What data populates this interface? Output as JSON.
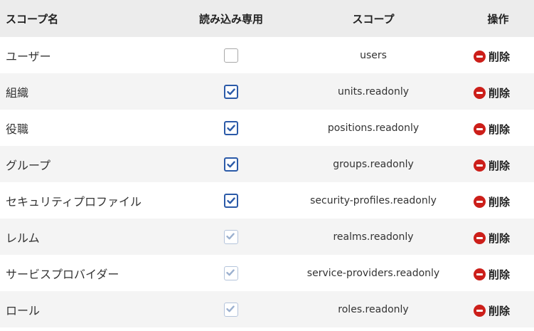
{
  "table": {
    "headers": {
      "name": "スコープ名",
      "readonly": "読み込み専用",
      "scope": "スコープ",
      "operation": "操作"
    },
    "delete_label": "削除",
    "rows": [
      {
        "name": "ユーザー",
        "scope": "users",
        "readonly": false,
        "disabled": false
      },
      {
        "name": "組織",
        "scope": "units.readonly",
        "readonly": true,
        "disabled": false
      },
      {
        "name": "役職",
        "scope": "positions.readonly",
        "readonly": true,
        "disabled": false
      },
      {
        "name": "グループ",
        "scope": "groups.readonly",
        "readonly": true,
        "disabled": false
      },
      {
        "name": "セキュリティプロファイル",
        "scope": "security-profiles.readonly",
        "readonly": true,
        "disabled": false
      },
      {
        "name": "レルム",
        "scope": "realms.readonly",
        "readonly": true,
        "disabled": true
      },
      {
        "name": "サービスプロバイダー",
        "scope": "service-providers.readonly",
        "readonly": true,
        "disabled": true
      },
      {
        "name": "ロール",
        "scope": "roles.readonly",
        "readonly": true,
        "disabled": true
      }
    ]
  },
  "colors": {
    "checkbox_checked": "#2b5aa8",
    "checkbox_disabled": "#9bb0cf",
    "delete_icon": "#cc1f1a"
  }
}
